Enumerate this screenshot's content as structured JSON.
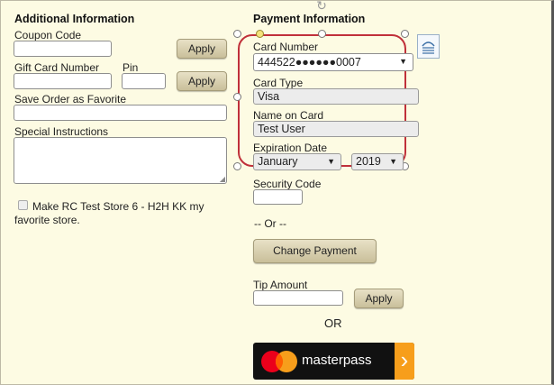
{
  "additional": {
    "heading": "Additional Information",
    "coupon_label": "Coupon Code",
    "coupon_value": "",
    "apply_label": "Apply",
    "gift_label": "Gift Card Number",
    "pin_label": "Pin",
    "gift_value": "",
    "pin_value": "",
    "favorite_label": "Save Order as Favorite",
    "favorite_value": "",
    "instructions_label": "Special Instructions",
    "instructions_value": "",
    "checkbox_line1": "Make RC Test Store 6 - H2H KK my",
    "checkbox_line2": "favorite store."
  },
  "payment": {
    "heading": "Payment Information",
    "card_number_label": "Card Number",
    "card_number_value": "444522●●●●●●0007",
    "card_type_label": "Card Type",
    "card_type_value": "Visa",
    "name_label": "Name on Card",
    "name_value": "Test User",
    "expiration_label": "Expiration Date",
    "exp_month": "January",
    "exp_year": "2019",
    "security_label": "Security Code",
    "security_value": "",
    "or_divider": "-- Or --",
    "change_payment_label": "Change Payment",
    "tip_label": "Tip Amount",
    "tip_value": "",
    "tip_apply_label": "Apply",
    "or_label": "OR",
    "masterpass_label": "masterpass",
    "masterpass_arrow": "›"
  },
  "colors": {
    "background": "#fdfbe3",
    "selection": "#c0303a",
    "masterpass_orange": "#f79e1b",
    "masterpass_red": "#eb001b"
  }
}
